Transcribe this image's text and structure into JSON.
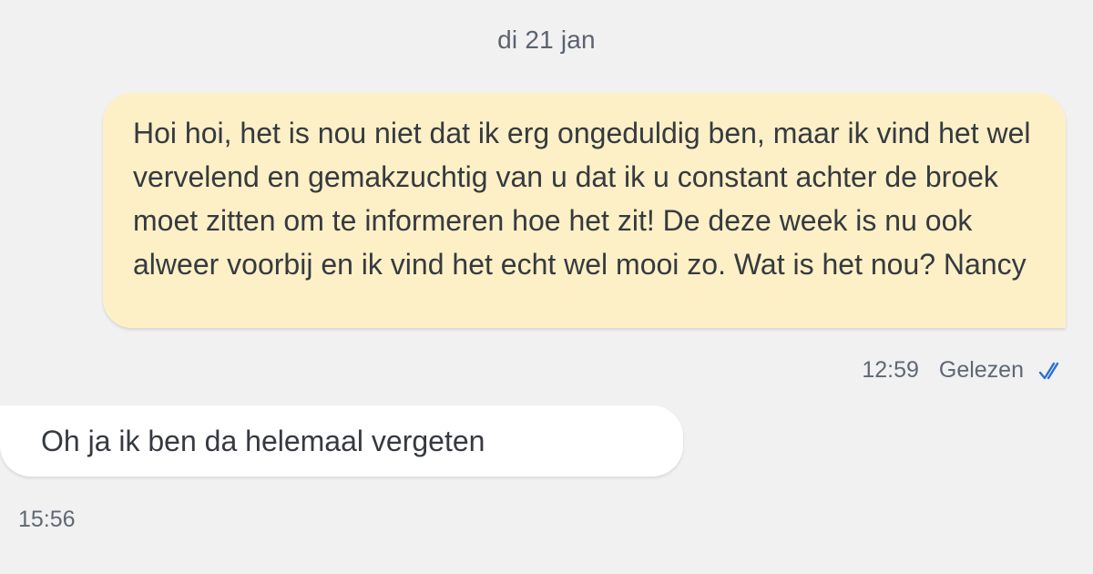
{
  "date_divider": "di 21 jan",
  "messages": [
    {
      "direction": "outgoing",
      "text": "Hoi hoi, het is nou niet dat ik erg ongeduldig ben, maar ik vind het wel vervelend en gemakzuchtig van u dat ik u constant achter de broek moet zitten om te informeren hoe het zit! De deze week is nu ook alweer voorbij en ik vind het echt wel mooi zo. Wat is het nou? Nancy",
      "time": "12:59",
      "status": "Gelezen",
      "status_icon": "double-check-icon"
    },
    {
      "direction": "incoming",
      "text": "Oh ja ik ben da helemaal vergeten",
      "time": "15:56"
    }
  ],
  "colors": {
    "background": "#f1f1f1",
    "outgoing_bubble": "#fdf0c6",
    "incoming_bubble": "#ffffff",
    "read_check": "#2b6fd6"
  }
}
